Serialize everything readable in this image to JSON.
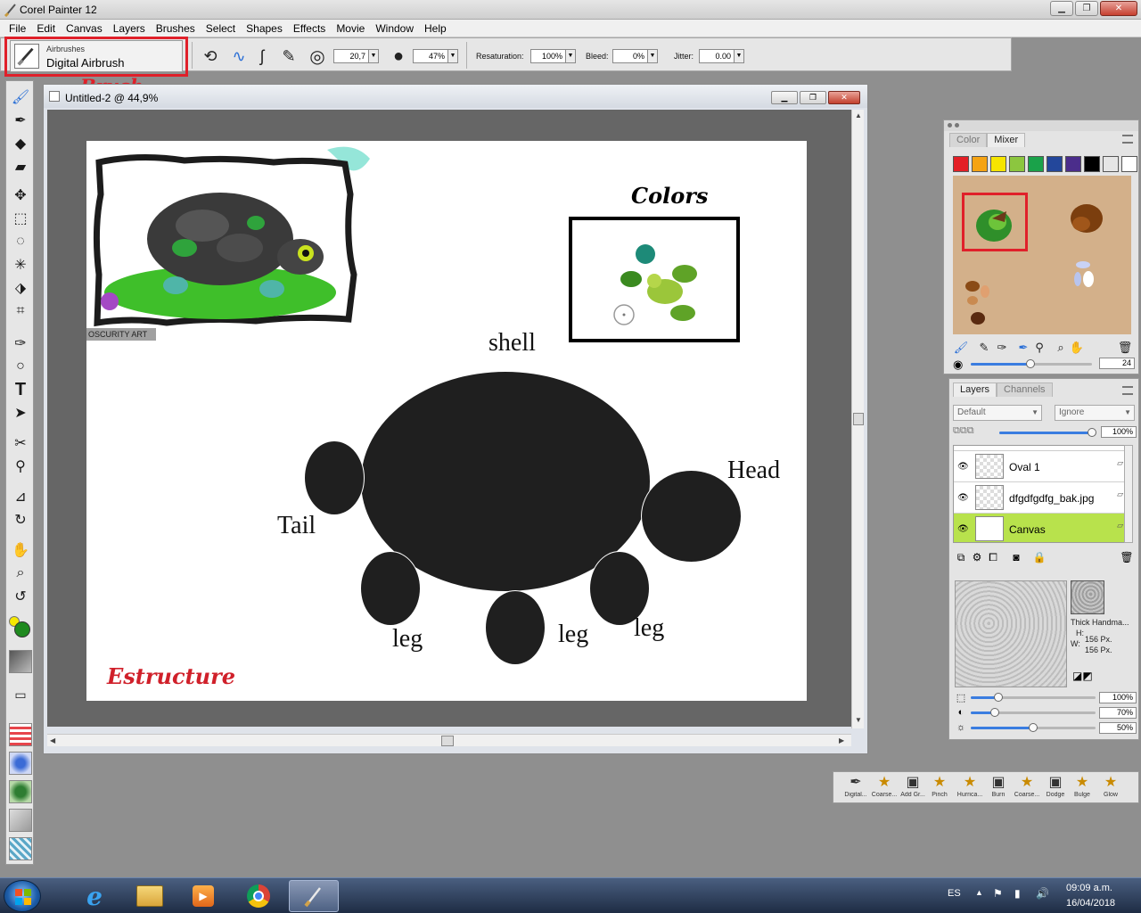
{
  "window": {
    "title": "Corel Painter 12",
    "controls": [
      "▁",
      "❐",
      "✕"
    ]
  },
  "menu": [
    "File",
    "Edit",
    "Canvas",
    "Layers",
    "Brushes",
    "Select",
    "Shapes",
    "Effects",
    "Movie",
    "Window",
    "Help"
  ],
  "propbar": {
    "brush_category": "Airbrushes",
    "brush_name": "Digital Airbrush",
    "size_value": "20,7",
    "opacity_value": "47%",
    "resaturation_label": "Resaturation:",
    "resaturation_value": "100%",
    "bleed_label": "Bleed:",
    "bleed_value": "0%",
    "jitter_label": "Jitter:",
    "jitter_value": "0.00"
  },
  "annotations": {
    "brush": "Brush",
    "colors": "Colors",
    "structure": "Estructure"
  },
  "document": {
    "title": "Untitled-2 @ 44,9%",
    "reference_credit": "OSCURITY ART",
    "labels": {
      "shell": "shell",
      "head": "Head",
      "tail": "Tail",
      "leg_left": "leg",
      "leg_center": "leg",
      "leg_right": "leg"
    }
  },
  "color_panel": {
    "tabs": [
      "Color",
      "Mixer"
    ],
    "swatches": [
      "#e41f26",
      "#f5a313",
      "#f6e500",
      "#8cc63f",
      "#1aa24a",
      "#23479b",
      "#4b2d8b",
      "#000000",
      "#e6e6e6",
      "#ffffff"
    ],
    "brush_size_value": "24"
  },
  "layers_panel": {
    "tabs": [
      "Layers",
      "Channels"
    ],
    "composite_method": "Default",
    "preserve": "Ignore",
    "opacity_value": "100%",
    "layers": [
      {
        "name": "Oval 1",
        "selected": false
      },
      {
        "name": "dfgdfgdfg_bak.jpg",
        "selected": false
      },
      {
        "name": "Canvas",
        "selected": true
      }
    ]
  },
  "paper_panel": {
    "paper_name": "Thick Handma...",
    "height_label": "H:",
    "height_value": "156 Px.",
    "width_label": "W:",
    "width_value": "156 Px.",
    "scale_value": "100%",
    "contrast_value": "70%",
    "brightness_value": "50%"
  },
  "brush_strip": [
    "Digital...",
    "Coarse...",
    "Add Gr...",
    "Pinch",
    "Hurrica...",
    "Burn",
    "Coarse...",
    "Dodge",
    "Bulge",
    "Glow"
  ],
  "taskbar": {
    "language": "ES",
    "time": "09:09 a.m.",
    "date": "16/04/2018"
  }
}
